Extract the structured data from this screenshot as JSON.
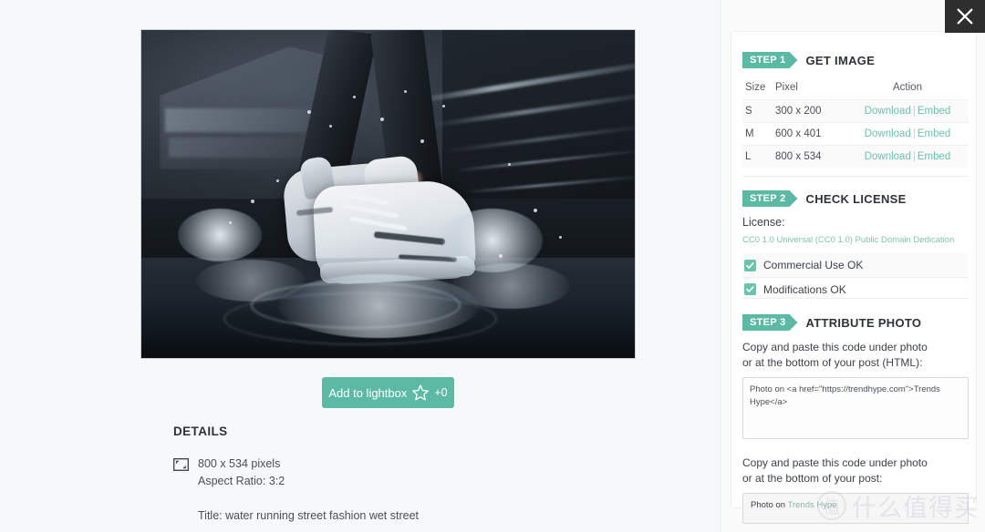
{
  "window": {
    "close_label": "×"
  },
  "photo": {
    "alt": "white sneakers splashing in water on dark street stairs"
  },
  "lightbox": {
    "label": "Add to lightbox",
    "icon": "star-icon",
    "count": "+0"
  },
  "details": {
    "heading": "DETAILS",
    "icon": "image-dimensions-icon",
    "dimensions": "800 x 534 pixels",
    "aspect_ratio": "Aspect Ratio: 3:2",
    "title": "Title: water running street fashion wet street"
  },
  "steps": {
    "step1": {
      "badge": "STEP 1",
      "title": "GET IMAGE",
      "table": {
        "headers": [
          "Size",
          "Pixel",
          "Action"
        ],
        "rows": [
          {
            "size": "S",
            "pixel": "300 x 200",
            "download": "Download",
            "separator": "|",
            "embed": "Embed"
          },
          {
            "size": "M",
            "pixel": "600 x 401",
            "download": "Download",
            "separator": "|",
            "embed": "Embed"
          },
          {
            "size": "L",
            "pixel": "800 x 534",
            "download": "Download",
            "separator": "|",
            "embed": "Embed"
          }
        ]
      }
    },
    "step2": {
      "badge": "STEP 2",
      "title": "CHECK LICENSE",
      "license_label": "License:",
      "license_link": "CC0 1.0 Universal (CC0 1.0) Public Domain Dedication",
      "checks": [
        {
          "label": "Commercial Use OK",
          "checked": true
        },
        {
          "label": "Modifications OK",
          "checked": true
        }
      ]
    },
    "step3": {
      "badge": "STEP 3",
      "title": "ATTRIBUTE PHOTO",
      "html_instructions_line1": "Copy and paste this code under photo",
      "html_instructions_line2": "or at the bottom of your post (HTML):",
      "html_code": "Photo on <a href=\"https://trendhype.com\">Trends Hype</a>",
      "text_instructions_line1": "Copy and paste this code under photo",
      "text_instructions_line2": "or at the bottom of your post:",
      "text_code_prefix": "Photo on ",
      "text_code_link": "Trends Hype"
    }
  },
  "watermark": {
    "logo": "值",
    "text": "什么值得买"
  },
  "colors": {
    "accent": "#5cb9a3",
    "link": "#6fc0ac",
    "panel_bg": "#fbfbfc",
    "page_bg": "#f7f8fa",
    "close_bg": "#2e2e2e"
  }
}
